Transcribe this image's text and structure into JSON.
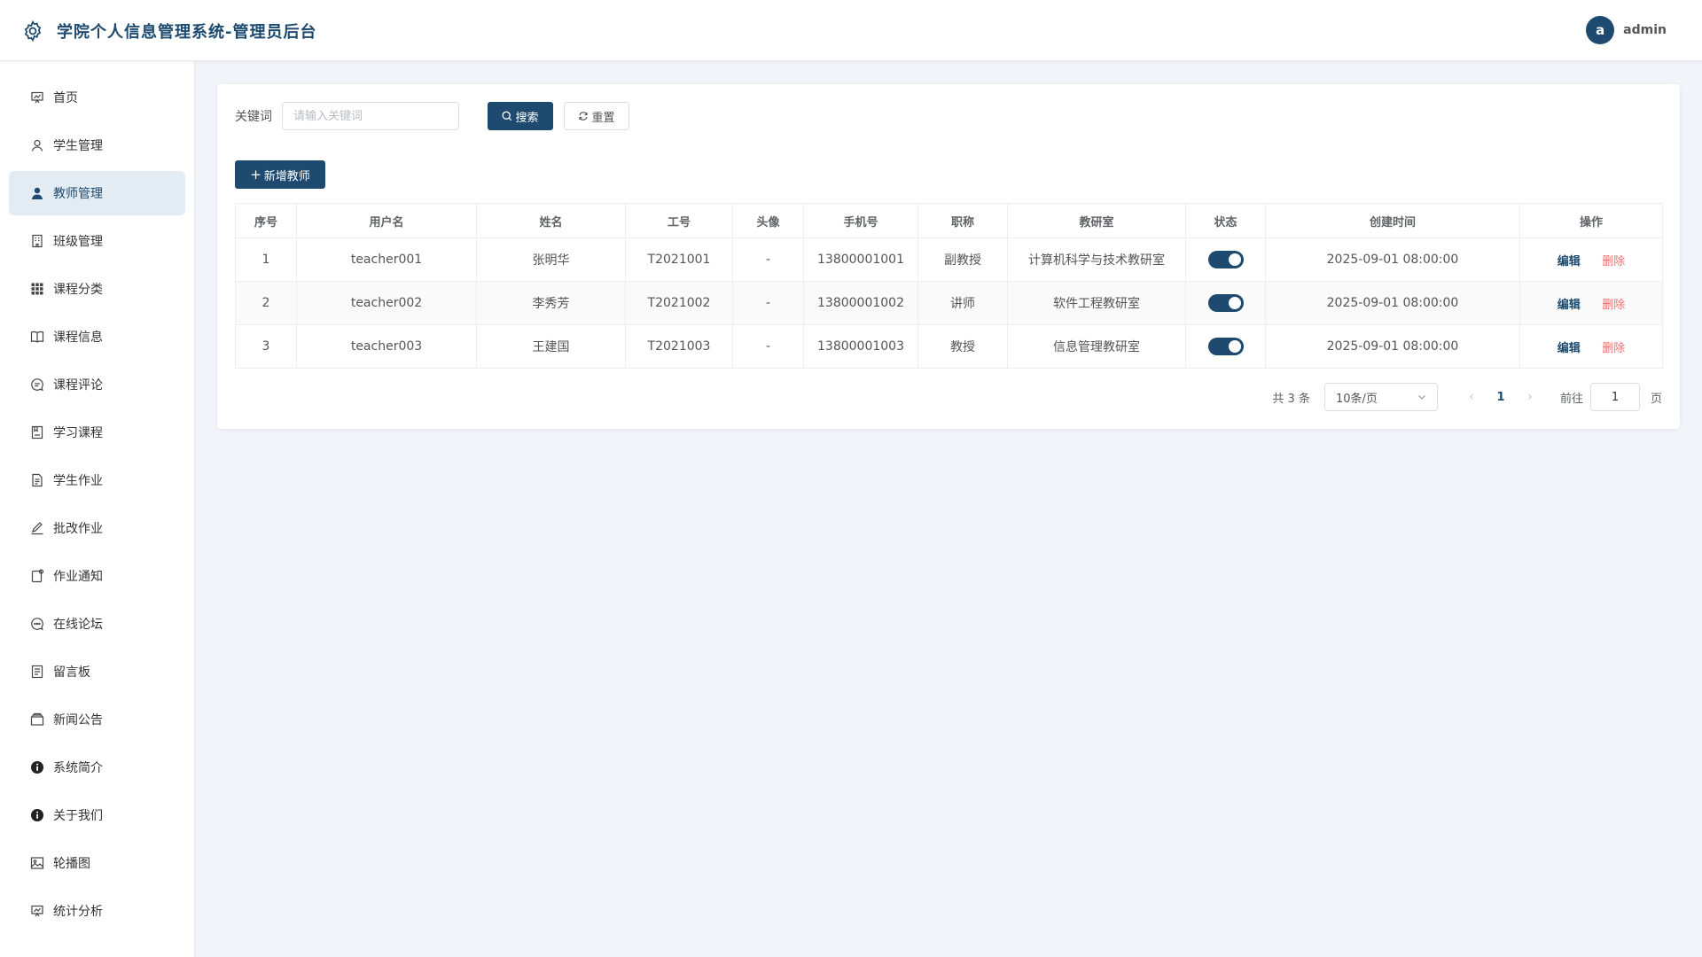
{
  "header": {
    "title": "学院个人信息管理系统-管理员后台",
    "avatar_letter": "a",
    "username": "admin"
  },
  "sidebar": {
    "items": [
      {
        "label": "首页",
        "icon": "dashboard-icon"
      },
      {
        "label": "学生管理",
        "icon": "user-outline-icon"
      },
      {
        "label": "教师管理",
        "icon": "user-filled-icon",
        "active": true
      },
      {
        "label": "班级管理",
        "icon": "building-icon"
      },
      {
        "label": "课程分类",
        "icon": "grid-icon"
      },
      {
        "label": "课程信息",
        "icon": "book-icon"
      },
      {
        "label": "课程评论",
        "icon": "comment-icon"
      },
      {
        "label": "学习课程",
        "icon": "notebook-icon"
      },
      {
        "label": "学生作业",
        "icon": "document-icon"
      },
      {
        "label": "批改作业",
        "icon": "pen-icon"
      },
      {
        "label": "作业通知",
        "icon": "notice-icon"
      },
      {
        "label": "在线论坛",
        "icon": "chat-icon"
      },
      {
        "label": "留言板",
        "icon": "memo-icon"
      },
      {
        "label": "新闻公告",
        "icon": "box-icon"
      },
      {
        "label": "系统简介",
        "icon": "info-icon"
      },
      {
        "label": "关于我们",
        "icon": "info-icon"
      },
      {
        "label": "轮播图",
        "icon": "image-icon"
      },
      {
        "label": "统计分析",
        "icon": "chart-icon"
      }
    ]
  },
  "search": {
    "label": "关键词",
    "placeholder": "请输入关键词",
    "value": "",
    "search_label": "搜索",
    "reset_label": "重置"
  },
  "toolbar": {
    "add_label": "新增教师"
  },
  "table": {
    "columns": [
      "序号",
      "用户名",
      "姓名",
      "工号",
      "头像",
      "手机号",
      "职称",
      "教研室",
      "状态",
      "创建时间",
      "操作"
    ],
    "rows": [
      {
        "index": "1",
        "username": "teacher001",
        "name": "张明华",
        "emp_no": "T2021001",
        "avatar": "-",
        "phone": "13800001001",
        "title": "副教授",
        "office": "计算机科学与技术教研室",
        "status": true,
        "created": "2025-09-01 08:00:00"
      },
      {
        "index": "2",
        "username": "teacher002",
        "name": "李秀芳",
        "emp_no": "T2021002",
        "avatar": "-",
        "phone": "13800001002",
        "title": "讲师",
        "office": "软件工程教研室",
        "status": true,
        "created": "2025-09-01 08:00:00"
      },
      {
        "index": "3",
        "username": "teacher003",
        "name": "王建国",
        "emp_no": "T2021003",
        "avatar": "-",
        "phone": "13800001003",
        "title": "教授",
        "office": "信息管理教研室",
        "status": true,
        "created": "2025-09-01 08:00:00"
      }
    ],
    "edit_label": "编辑",
    "delete_label": "删除"
  },
  "pagination": {
    "total_text": "共 3 条",
    "page_size": "10条/页",
    "current_page": "1",
    "goto_label": "前往",
    "goto_value": "1",
    "goto_suffix": "页"
  },
  "colors": {
    "primary": "#1d4a6e",
    "danger": "#f06b6b",
    "active_bg": "#e3ebf3",
    "page_bg": "#f1f4f8"
  }
}
